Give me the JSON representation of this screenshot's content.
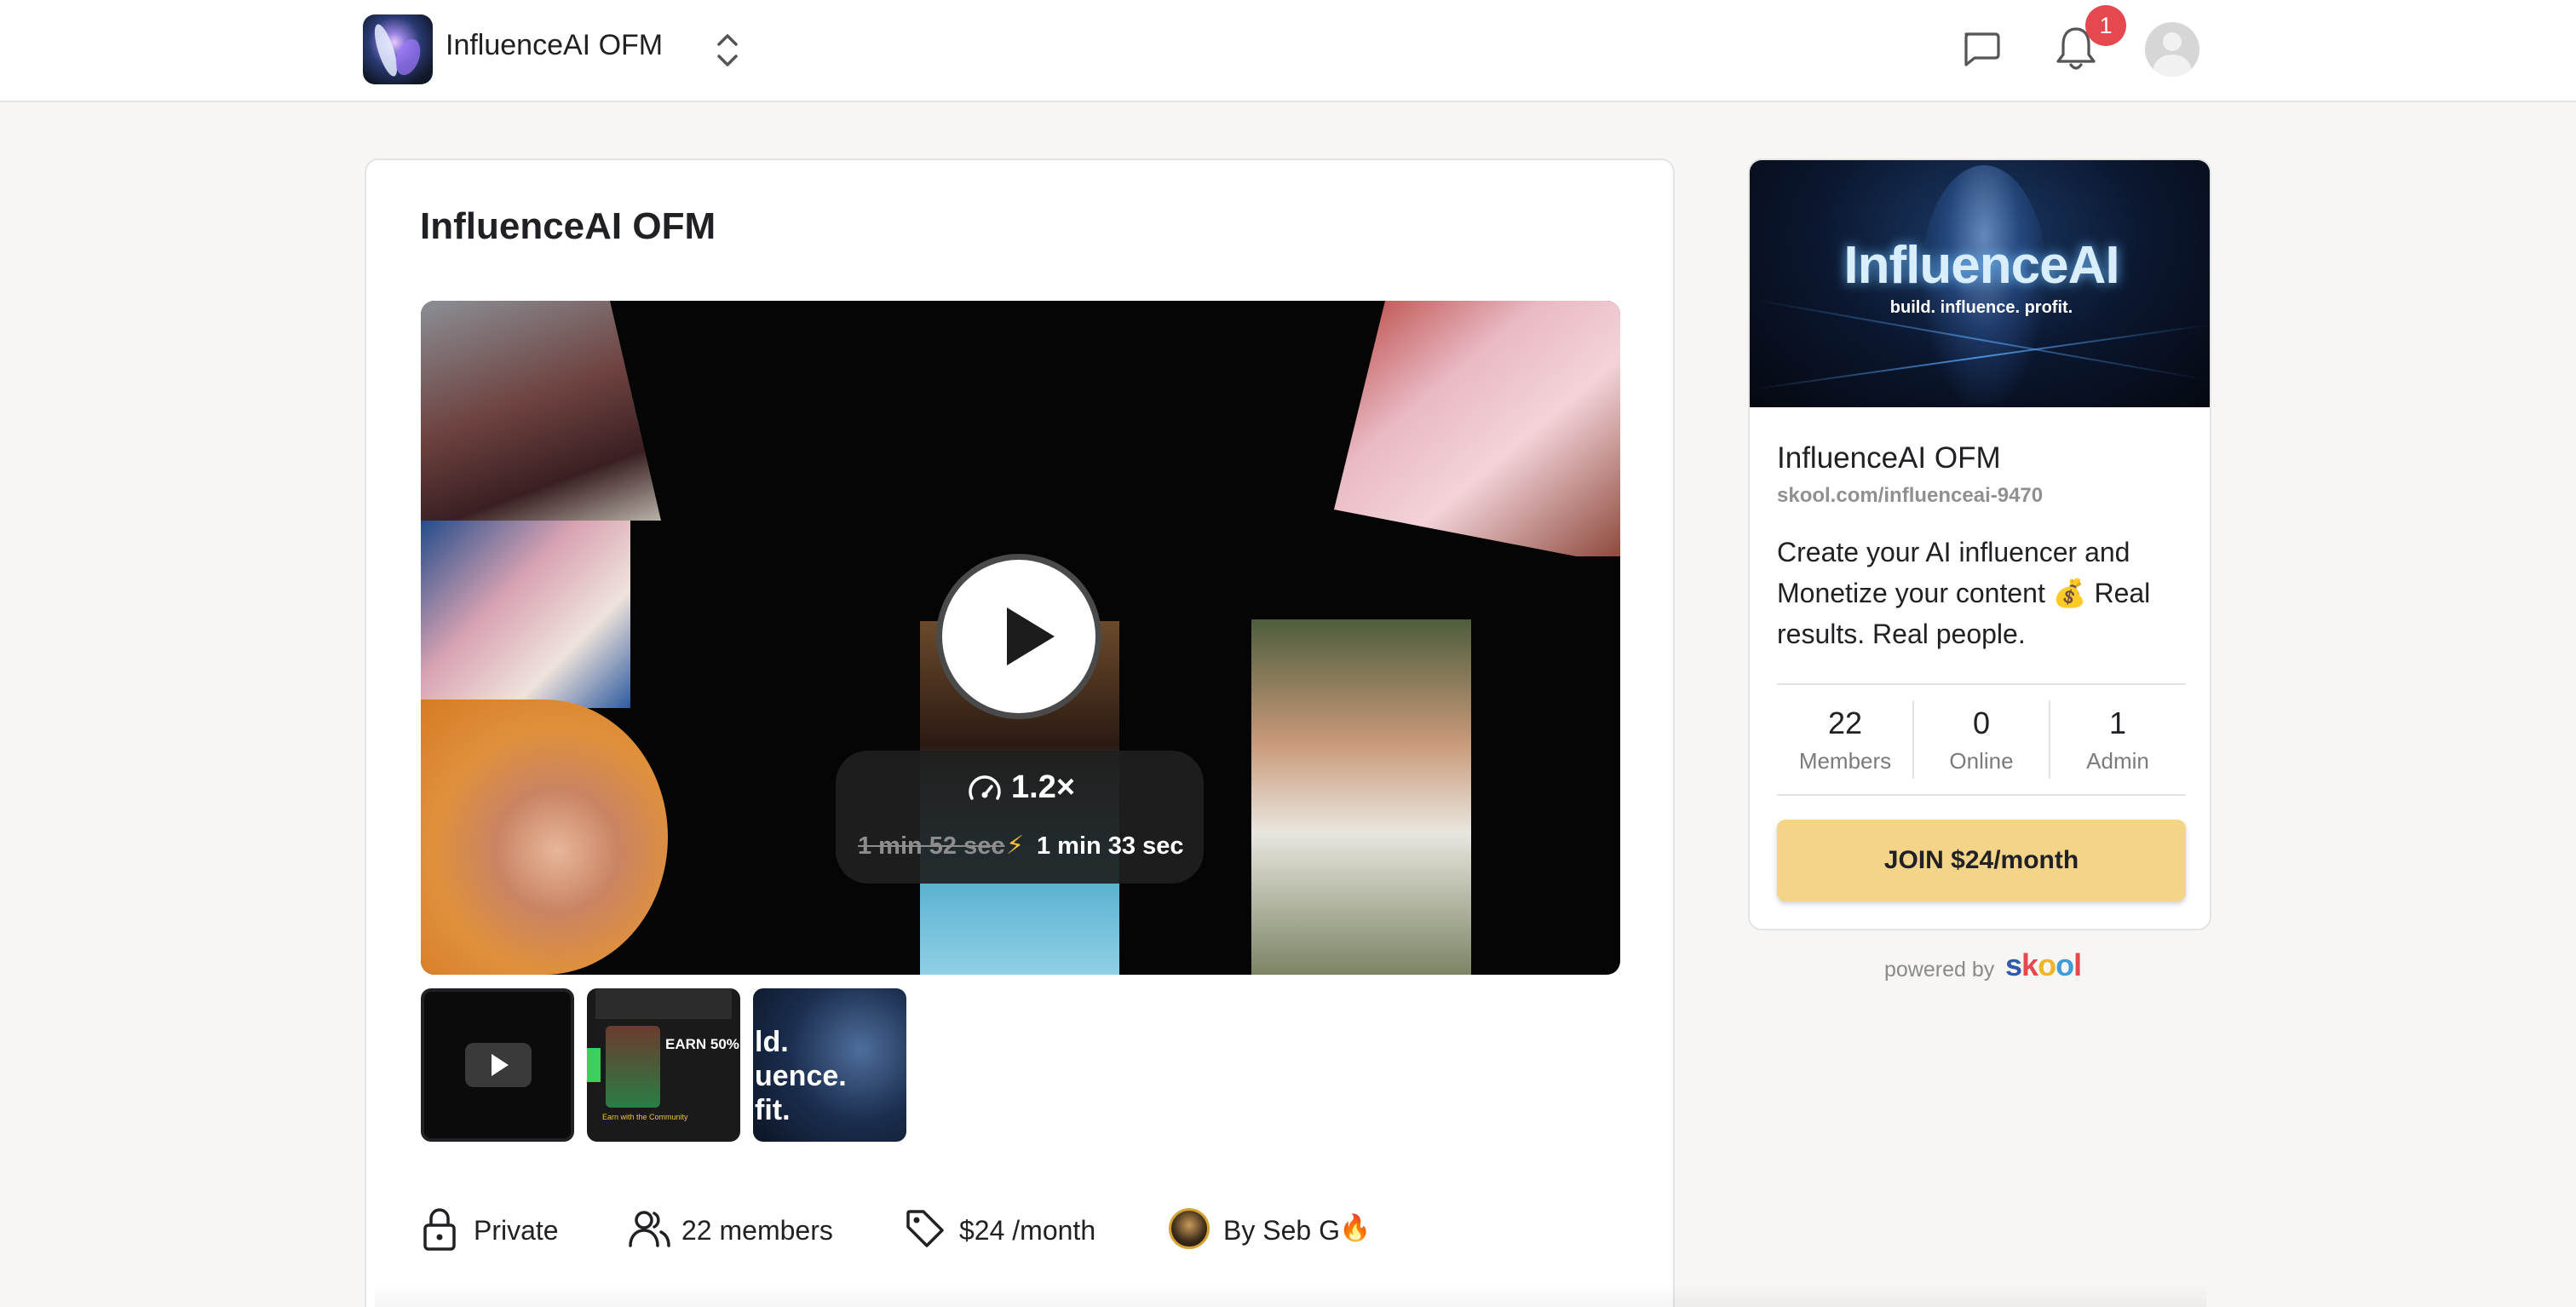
{
  "header": {
    "brand_name": "InfluenceAI OFM",
    "notification_count": "1",
    "icons": [
      "community-switcher-icon",
      "chat-icon",
      "bell-icon",
      "user-avatar"
    ]
  },
  "main": {
    "title": "InfluenceAI OFM",
    "video": {
      "speed": "1.2×",
      "original_duration": "1 min 52 sec",
      "fast_duration": "1 min 33 sec"
    },
    "thumbnails": [
      {
        "kind": "video",
        "icon": "play-icon"
      },
      {
        "kind": "image",
        "headline": "EARN 50%",
        "caption": "Earn with the Community"
      },
      {
        "kind": "image",
        "text_lines": [
          "ld.",
          "uence.",
          "fit."
        ]
      }
    ],
    "meta": {
      "privacy": "Private",
      "members": "22 members",
      "price": "$24 /month",
      "author": "By Seb G",
      "author_emoji": "🔥"
    }
  },
  "sidebar": {
    "banner_title": "InfluenceAI",
    "banner_subtitle": "build. influence. profit.",
    "name": "InfluenceAI OFM",
    "url": "skool.com/influenceai-9470",
    "description": "Create your AI influencer and Monetize your content 💰 Real results. Real people.",
    "stats": [
      {
        "value": "22",
        "label": "Members"
      },
      {
        "value": "0",
        "label": "Online"
      },
      {
        "value": "1",
        "label": "Admin"
      }
    ],
    "join_label": "JOIN $24/month",
    "powered_by": "powered by",
    "powered_brand": "skool"
  },
  "colors": {
    "join_button": "#f3d488",
    "badge": "#e5484d",
    "page_bg": "#f7f6f4"
  }
}
